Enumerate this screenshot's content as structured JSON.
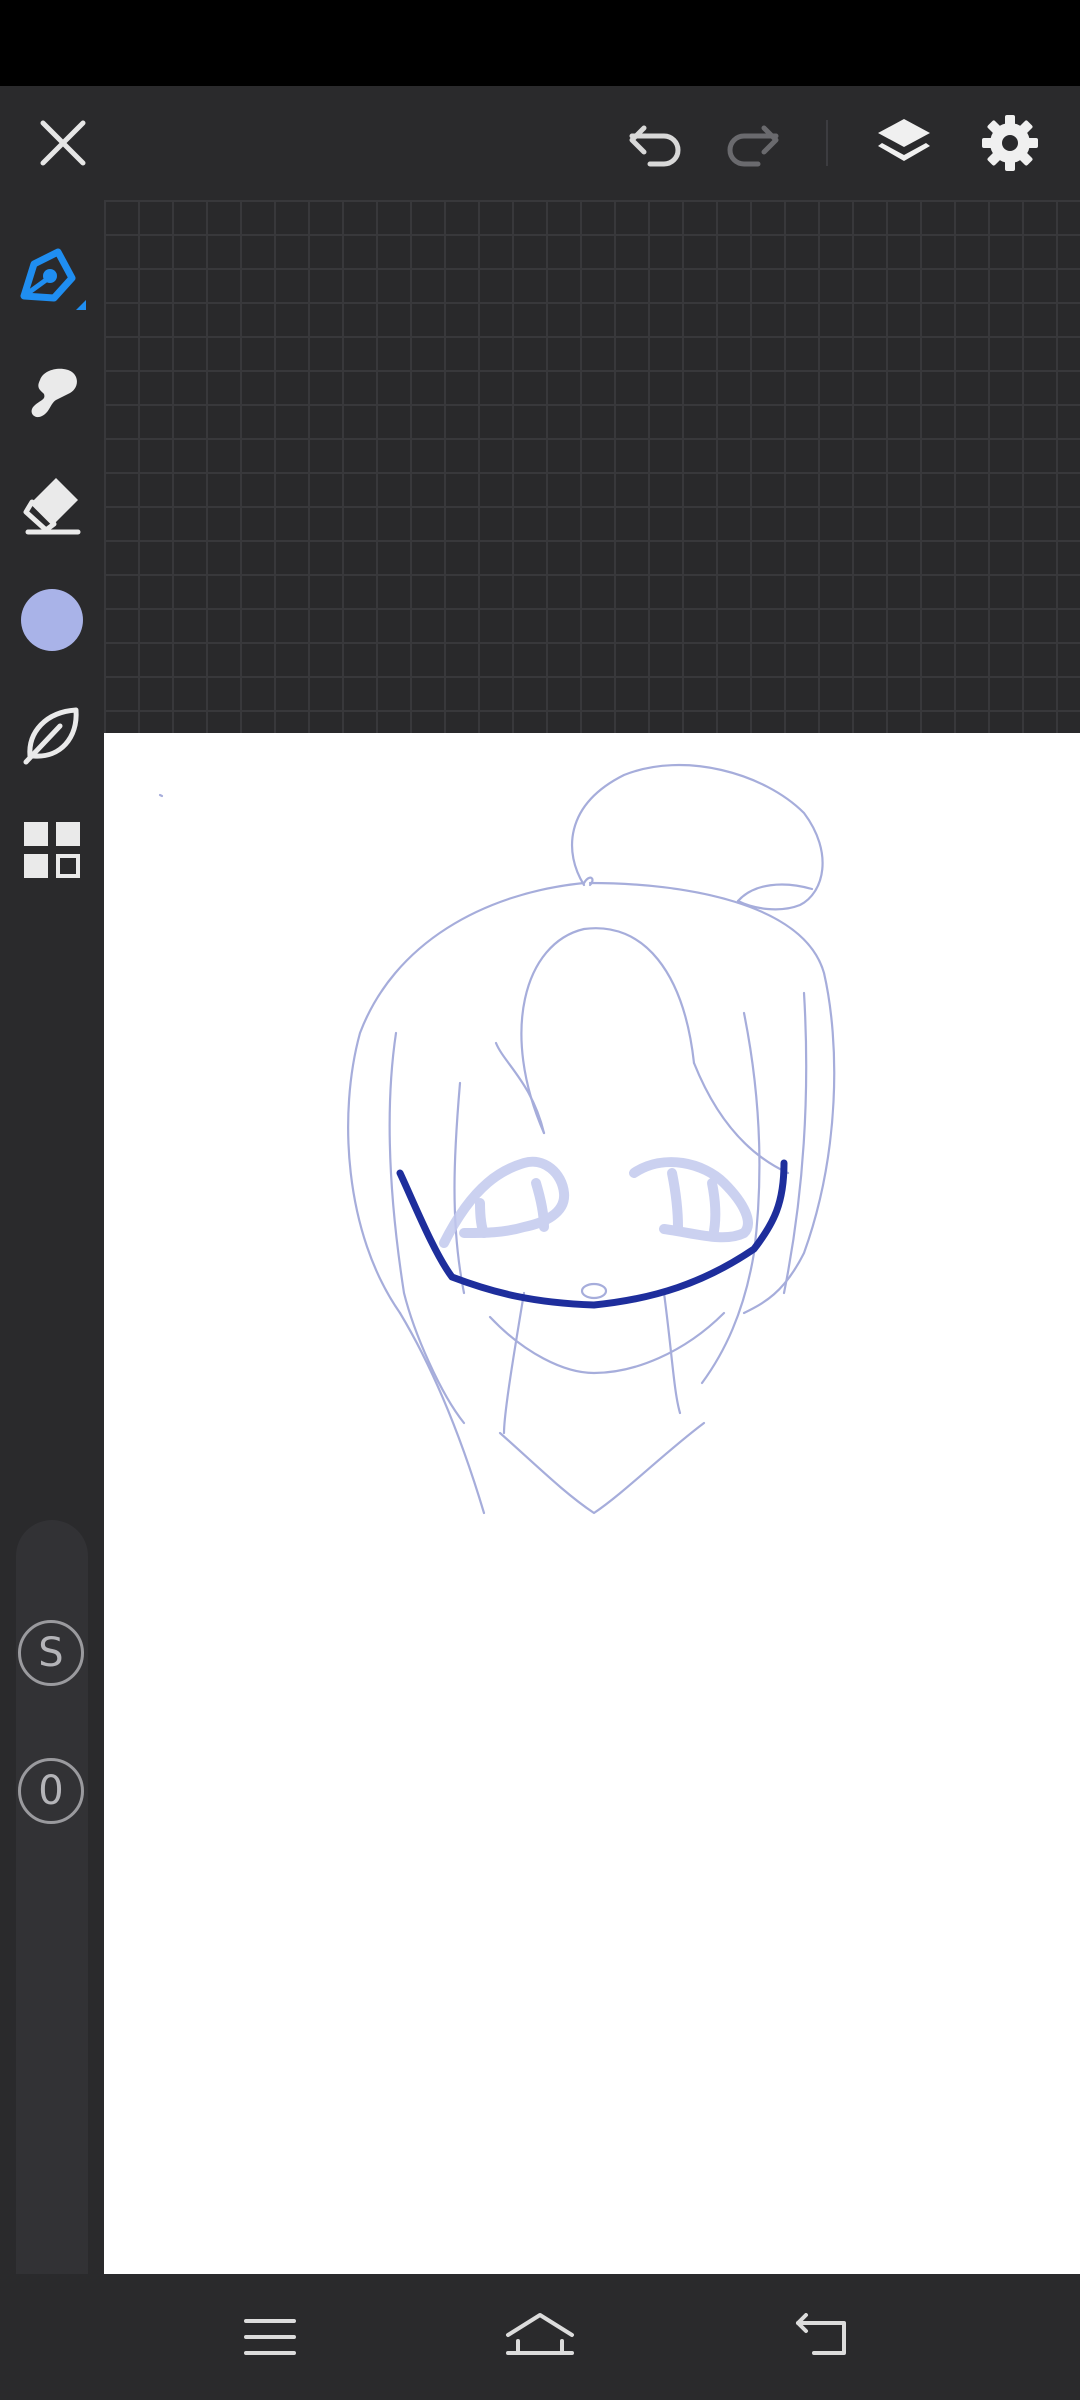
{
  "app": {
    "colors": {
      "toolbar_bg": "#2a2a2c",
      "accent_blue": "#1f8ef1",
      "brush_color": "#a9b3e8",
      "sketch_line": "#a6addb",
      "ink_line": "#1e2e9c",
      "icon_light": "#e6e6e6"
    }
  },
  "top_bar": {
    "icons": [
      "close-icon",
      "undo-icon",
      "redo-icon",
      "layers-icon",
      "settings-icon"
    ]
  },
  "sidebar": {
    "tools": [
      {
        "id": "pen",
        "icon": "pen-icon",
        "active": true
      },
      {
        "id": "smudge",
        "icon": "smudge-icon",
        "active": false
      },
      {
        "id": "eraser",
        "icon": "eraser-icon",
        "active": false
      },
      {
        "id": "color",
        "icon": "color-swatch",
        "active": false
      },
      {
        "id": "brush",
        "icon": "leaf-brush-icon",
        "active": false
      },
      {
        "id": "gallery",
        "icon": "grid-icon",
        "active": false
      }
    ],
    "size_label": "S",
    "opacity_label": "0"
  },
  "nav_bar": {
    "icons": [
      "menu-icon",
      "home-icon",
      "back-icon"
    ]
  }
}
